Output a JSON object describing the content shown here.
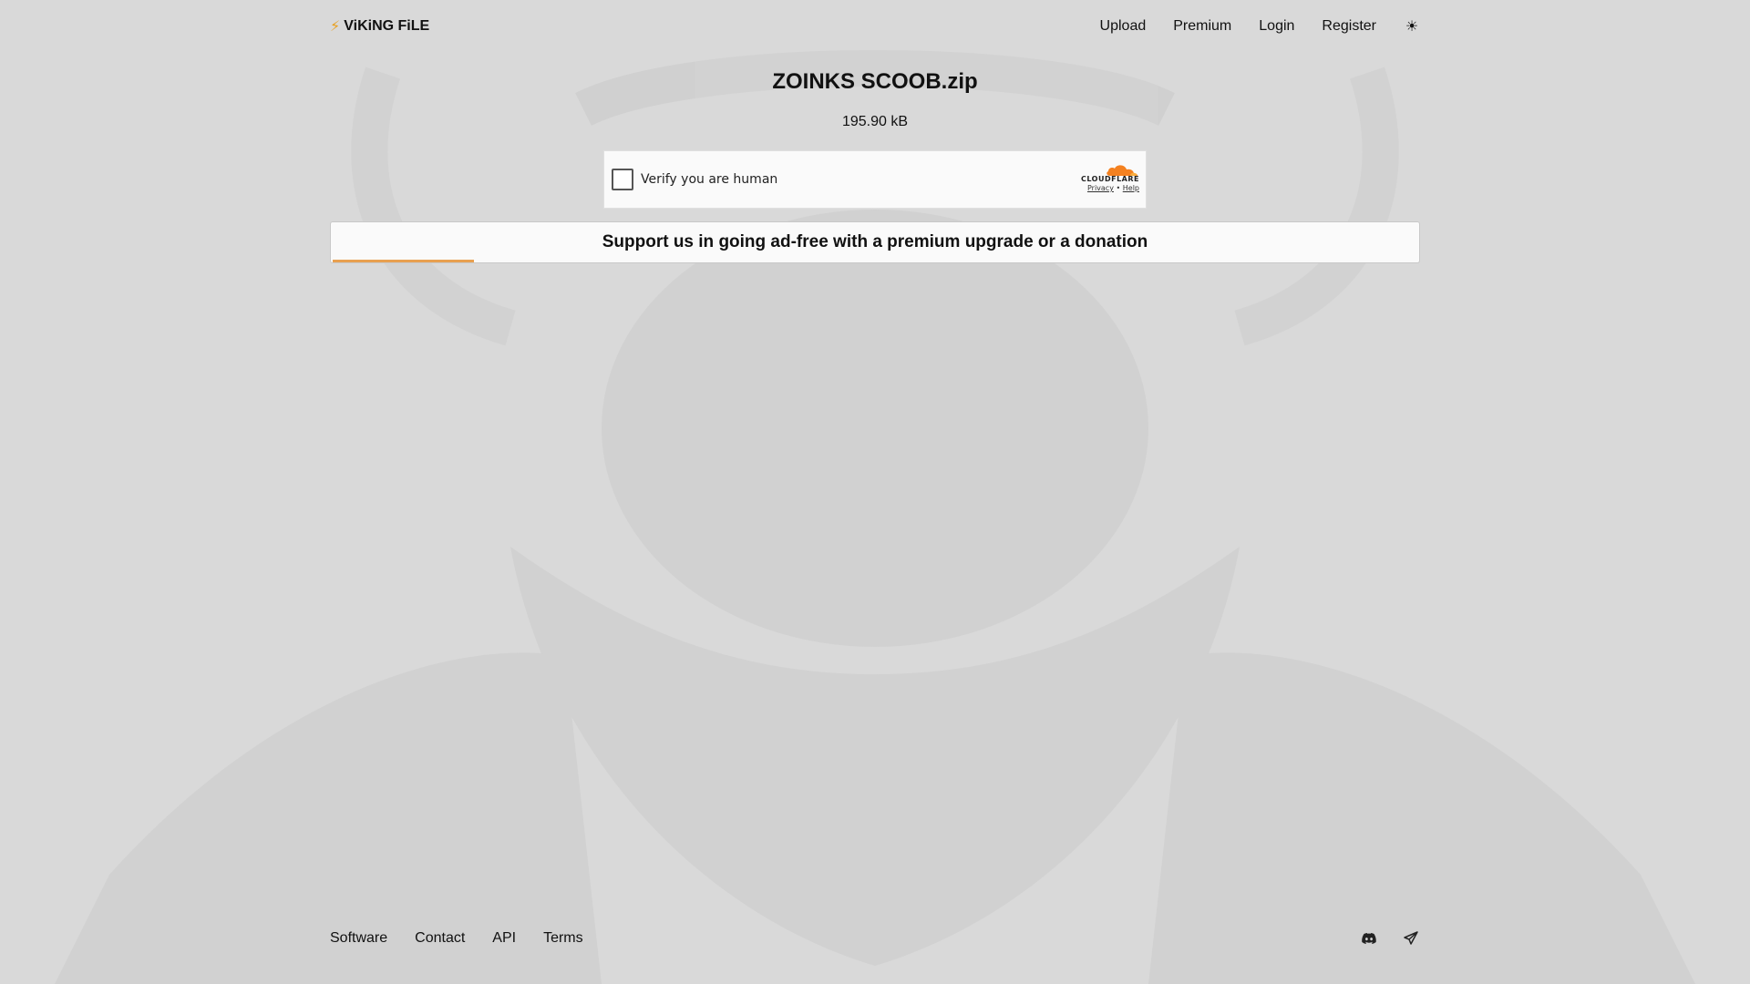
{
  "header": {
    "brand_icon": "lightning-bolt-icon",
    "brand_text": "ViKiNG FiLE",
    "nav": {
      "upload": "Upload",
      "premium": "Premium",
      "login": "Login",
      "register": "Register"
    },
    "theme_icon": "sun-icon",
    "theme_glyph": "☀"
  },
  "file": {
    "name": "ZOINKS SCOOB.zip",
    "size": "195.90 kB"
  },
  "captcha": {
    "label": "Verify you are human",
    "provider": "CLOUDFLARE",
    "privacy": "Privacy",
    "separator": "•",
    "help": "Help",
    "accent_color": "#f48120"
  },
  "support": {
    "text": "Support us in going ad-free with a premium upgrade or a donation",
    "progress": 0.13,
    "progress_color": "#e8a050"
  },
  "footer": {
    "links": {
      "software": "Software",
      "contact": "Contact",
      "api": "API",
      "terms": "Terms"
    },
    "icons": [
      "discord-icon",
      "telegram-icon"
    ]
  },
  "colors": {
    "background": "#d9d9d9",
    "text": "#111111",
    "accent": "#e8a020"
  }
}
